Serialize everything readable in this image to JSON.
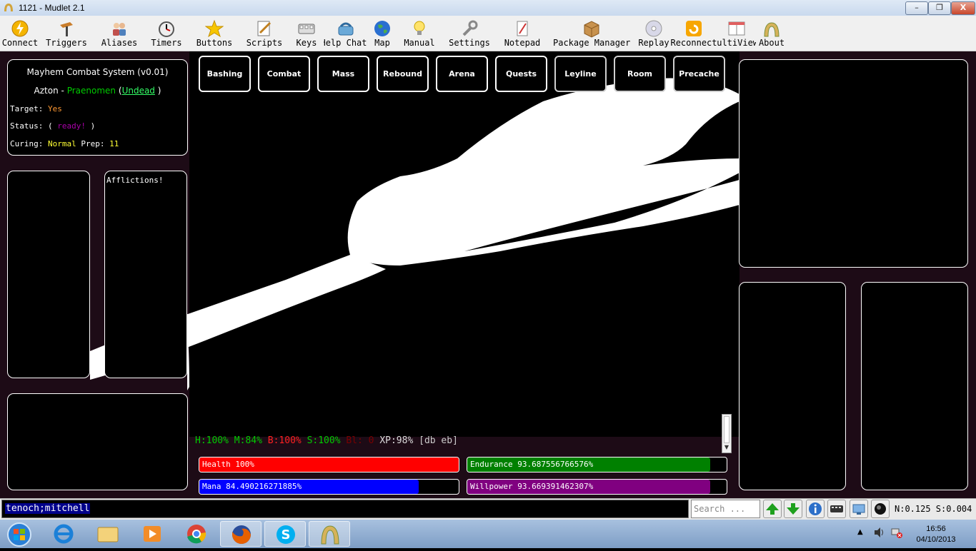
{
  "window": {
    "title": "1121 - Mudlet 2.1",
    "controls": [
      "–",
      "❐",
      "X"
    ]
  },
  "toolbar": [
    {
      "label": "Connect",
      "icon": "connect-icon"
    },
    {
      "label": "Triggers",
      "icon": "triggers-icon"
    },
    {
      "label": "Aliases",
      "icon": "aliases-icon"
    },
    {
      "label": "Timers",
      "icon": "timers-icon"
    },
    {
      "label": "Buttons",
      "icon": "buttons-icon"
    },
    {
      "label": "Scripts",
      "icon": "scripts-icon"
    },
    {
      "label": "Keys",
      "icon": "keys-icon"
    },
    {
      "label": "Help Chat",
      "icon": "help-chat-icon"
    },
    {
      "label": "Map",
      "icon": "map-icon"
    },
    {
      "label": "Manual",
      "icon": "manual-icon"
    },
    {
      "label": "Settings",
      "icon": "settings-icon"
    },
    {
      "label": "Notepad",
      "icon": "notepad-icon"
    },
    {
      "label": "Package Manager",
      "icon": "package-manager-icon"
    },
    {
      "label": "Replay",
      "icon": "replay-icon"
    },
    {
      "label": "Reconnect",
      "icon": "reconnect-icon"
    },
    {
      "label": "MultiView",
      "icon": "multiview-icon"
    },
    {
      "label": "About",
      "icon": "about-icon"
    }
  ],
  "mayhem": {
    "title": "Mayhem Combat System (v0.01)",
    "char_name": "Azton",
    "sep": "-",
    "char_class": "Praenomen",
    "paren_open": "(",
    "char_race": "Undead",
    "paren_close": ")",
    "target_label": "Target:",
    "target_value": "Yes",
    "status_label": "Status:",
    "status_open": "(",
    "status_value": "ready!",
    "status_close": ")",
    "curing_label": "Curing:",
    "curing_value": "Normal",
    "prep_label": "Prep:",
    "prep_value": "11"
  },
  "afflictions": {
    "label": "Afflictions!"
  },
  "categories": [
    "Bashing",
    "Combat",
    "Mass",
    "Rebound",
    "Arena",
    "Quests",
    "Leyline",
    "Room",
    "Precache"
  ],
  "prompt": {
    "h": "H:100%",
    "m": "M:84%",
    "b": "B:100%",
    "s": "S:100%",
    "bl": "Bl: 0",
    "xp": "XP:98%",
    "flags": "[db eb]"
  },
  "bars": [
    {
      "label": "Health 100%",
      "value": 1.0,
      "color": "#ff0000"
    },
    {
      "label": "Endurance 93.687556766576%",
      "value": 0.9369,
      "color": "#008000"
    },
    {
      "label": "Mana 84.490216271885%",
      "value": 0.8449,
      "color": "#0000ff"
    },
    {
      "label": "Willpower 93.669391462307%",
      "value": 0.9367,
      "color": "#800080"
    }
  ],
  "command": {
    "value": "tenoch;mitchell",
    "search_placeholder": "Search ..."
  },
  "netstat": "N:0.125 S:0.004",
  "clock": {
    "time": "16:56",
    "date": "04/10/2013"
  },
  "colors": {
    "panel_bg": "#000000",
    "main_bg": "#1d0b16",
    "green": "#00cc00",
    "yellow": "#ffff33",
    "orange": "#ff9933",
    "purple": "#aa00aa",
    "undead": "#33ff66"
  }
}
